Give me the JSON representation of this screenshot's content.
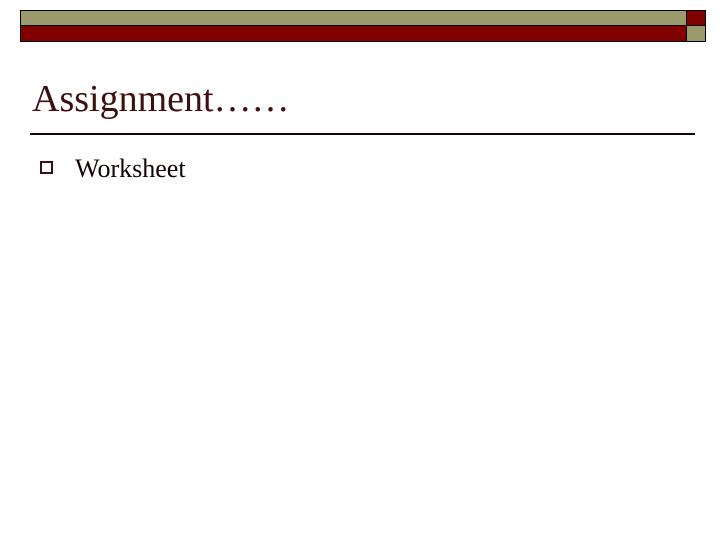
{
  "slide": {
    "title": "Assignment……",
    "header_banner": {
      "top_bar_color": "#9a9a6b",
      "bottom_bar_color": "#800000",
      "accent_top_color": "#800000",
      "accent_bottom_color": "#9a9a6b",
      "border_color": "#000000"
    },
    "title_color": "#3d0f0f",
    "rule_color": "#1a0505",
    "background_color": "#ffffff",
    "body": {
      "bullets": [
        {
          "marker": "hollow-square",
          "text": "Worksheet"
        }
      ]
    }
  }
}
